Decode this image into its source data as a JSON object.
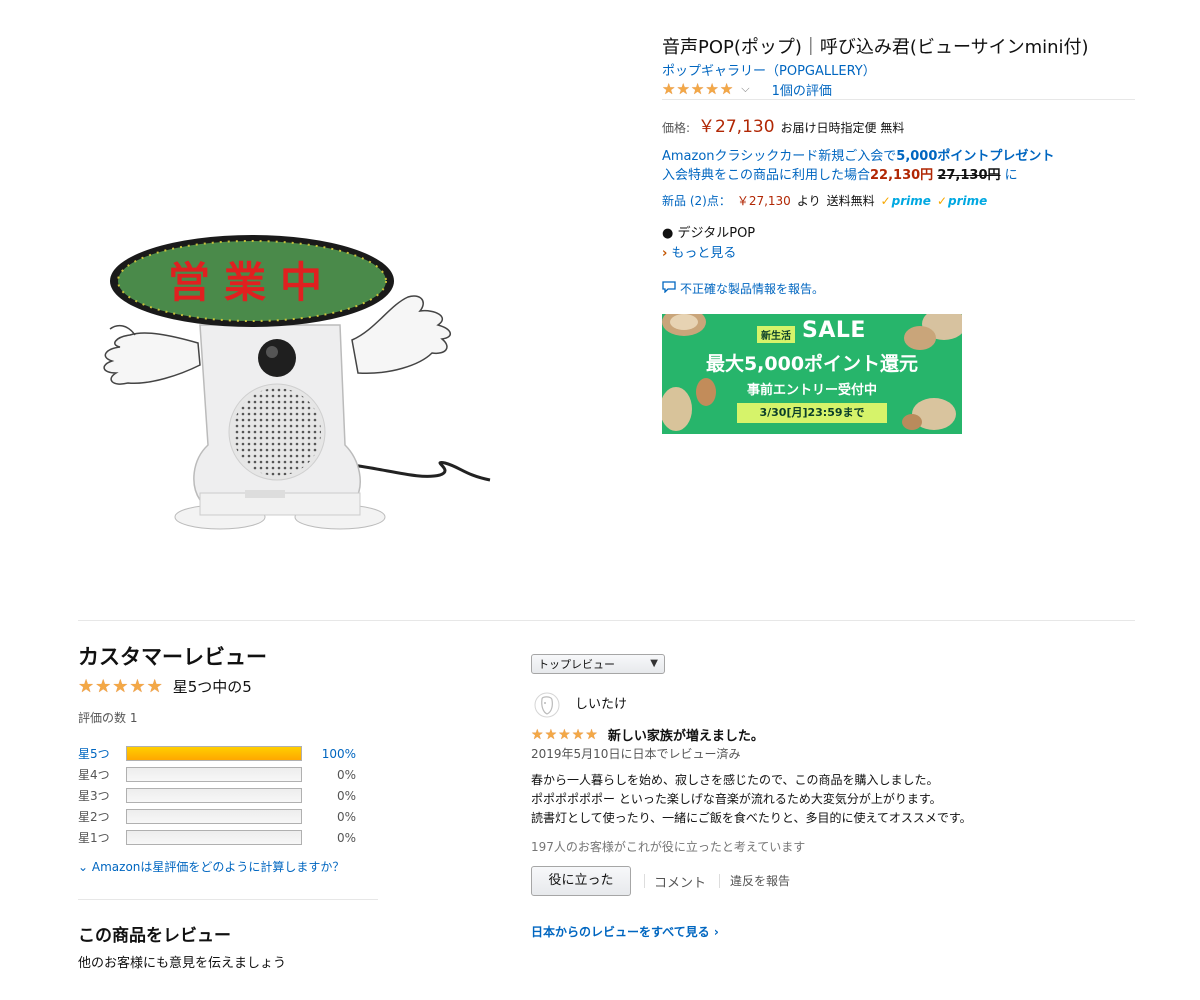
{
  "product": {
    "title": "音声POP(ポップ)｜呼び込み君(ビューサインmini付)",
    "brand": "ポップギャラリー（POPGALLERY）",
    "rating_stars": 5,
    "rating_count_label": "1個の評価",
    "image_sign_text": "営業中"
  },
  "price": {
    "label": "価格:",
    "value": "￥27,130",
    "delivery_note": "お届け日時指定便 無料"
  },
  "card_offer": {
    "line1_prefix": "Amazonクラシックカード新規ご入会で",
    "line1_points": "5,000ポイントプレゼント",
    "line2_prefix": "入会特典をこの商品に利用した場合",
    "line2_new_price": "22,130円",
    "line2_old_price": "27,130円",
    "line2_suffix": "に"
  },
  "new_offers": {
    "label": "新品 (2)点：",
    "price": "￥27,130",
    "from": "より",
    "shipping": "送料無料",
    "prime_label": "prime"
  },
  "features": {
    "bullet": "デジタルPOP",
    "more_link": "もっと見る"
  },
  "report_link": "不正確な製品情報を報告。",
  "sale_banner": {
    "badge": "新生活",
    "sale_word": "SALE",
    "main": "最大5,000ポイント還元",
    "sub": "事前エントリー受付中",
    "deadline": "3/30[月]23:59まで",
    "bg_color": "#27b56b"
  },
  "reviews": {
    "heading": "カスタマーレビュー",
    "overall_stars": 5,
    "overall_text": "星5つ中の5",
    "count_label": "評価の数 1",
    "histogram": [
      {
        "label": "星5つ",
        "percent": 100,
        "percent_label": "100%"
      },
      {
        "label": "星4つ",
        "percent": 0,
        "percent_label": "0%"
      },
      {
        "label": "星3つ",
        "percent": 0,
        "percent_label": "0%"
      },
      {
        "label": "星2つ",
        "percent": 0,
        "percent_label": "0%"
      },
      {
        "label": "星1つ",
        "percent": 0,
        "percent_label": "0%"
      }
    ],
    "how_calc_link": "Amazonは星評価をどのように計算しますか？",
    "write_heading": "この商品をレビュー",
    "write_sub": "他のお客様にも意見を伝えましょう",
    "sort_selected": "トップレビュー",
    "items": [
      {
        "reviewer": "しいたけ",
        "stars": 5,
        "title": "新しい家族が増えました。",
        "date": "2019年5月10日に日本でレビュー済み",
        "body": [
          "春から一人暮らしを始め、寂しさを感じたので、この商品を購入しました。",
          "ポポポポポポー といった楽しげな音楽が流れるため大変気分が上がります。",
          "読書灯として使ったり、一緒にご飯を食べたりと、多目的に使えてオススメです。"
        ],
        "helpful_count": "197人のお客様がこれが役に立ったと考えています",
        "helpful_button": "役に立った",
        "comment_link": "コメント",
        "report_link": "違反を報告"
      }
    ],
    "see_all_link": "日本からのレビューをすべて見る ›"
  },
  "colors": {
    "link": "#0066c0",
    "price_red": "#b12704",
    "star": "#f3a847",
    "bar_fill": "#ffa700"
  }
}
